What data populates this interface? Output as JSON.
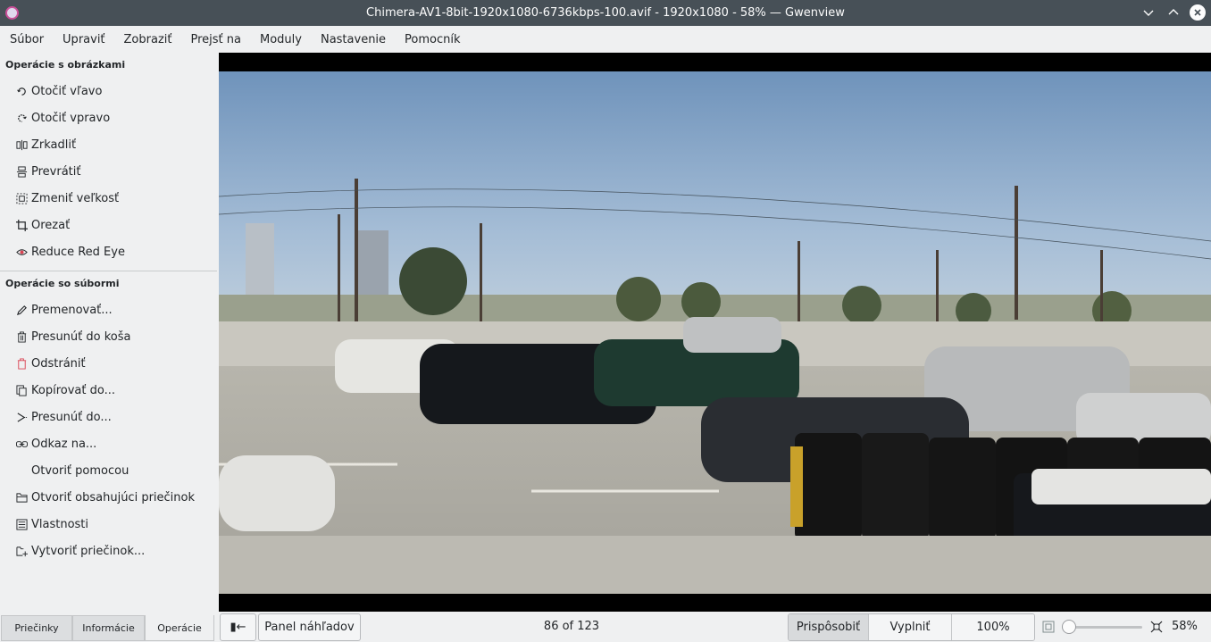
{
  "window": {
    "title": "Chimera-AV1-8bit-1920x1080-6736kbps-100.avif - 1920x1080 - 58% — Gwenview",
    "minimize_icon": "chevron-down-icon",
    "maximize_icon": "chevron-up-icon",
    "close_icon": "close-icon"
  },
  "menu": [
    "Súbor",
    "Upraviť",
    "Zobraziť",
    "Prejsť na",
    "Moduly",
    "Nastavenie",
    "Pomocník"
  ],
  "sidebar": {
    "image_ops_title": "Operácie s obrázkami",
    "image_ops": [
      {
        "label": "Otočiť vľavo",
        "icon": "rotate-left-icon"
      },
      {
        "label": "Otočiť vpravo",
        "icon": "rotate-right-icon"
      },
      {
        "label": "Zrkadliť",
        "icon": "mirror-icon"
      },
      {
        "label": "Prevrátiť",
        "icon": "flip-icon"
      },
      {
        "label": "Zmeniť veľkosť",
        "icon": "resize-icon"
      },
      {
        "label": "Orezať",
        "icon": "crop-icon"
      },
      {
        "label": "Reduce Red Eye",
        "icon": "red-eye-icon"
      }
    ],
    "file_ops_title": "Operácie so súbormi",
    "file_ops": [
      {
        "label": "Premenovať...",
        "icon": "pencil-icon"
      },
      {
        "label": "Presunúť do koša",
        "icon": "trash-icon"
      },
      {
        "label": "Odstrániť",
        "icon": "delete-icon"
      },
      {
        "label": "Kopírovať do...",
        "icon": "copy-icon"
      },
      {
        "label": "Presunúť do...",
        "icon": "move-icon"
      },
      {
        "label": "Odkaz na...",
        "icon": "link-icon"
      },
      {
        "label": "Otvoriť pomocou",
        "icon": ""
      },
      {
        "label": "Otvoriť obsahujúci priečinok",
        "icon": "folder-icon"
      },
      {
        "label": "Vlastnosti",
        "icon": "properties-icon"
      },
      {
        "label": "Vytvoriť priečinok...",
        "icon": "new-folder-icon"
      }
    ]
  },
  "bottom": {
    "tabs": [
      "Priečinky",
      "Informácie",
      "Operácie"
    ],
    "sidebar_toggle": "▮←",
    "thumbnail_bar": "Panel náhľadov",
    "counter": "86 of 123",
    "zoom_modes": [
      "Prispôsobiť",
      "Vyplniť",
      "100%"
    ],
    "zoom_level": 0.0,
    "zoom_value": "58%"
  },
  "colors": {
    "titlebar": "#475057",
    "window_bg": "#eff0f1",
    "accent_red": "#da4453"
  }
}
